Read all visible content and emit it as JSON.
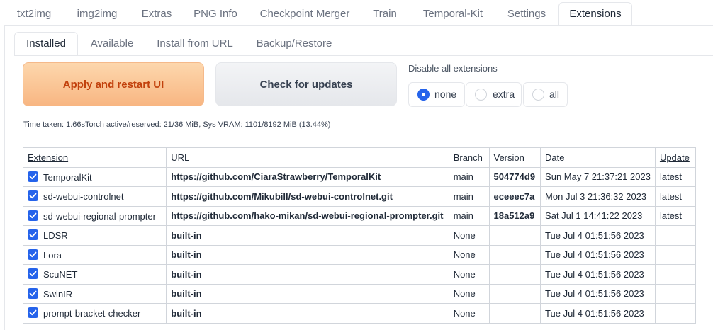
{
  "top_tabs": [
    {
      "label": "txt2img"
    },
    {
      "label": "img2img"
    },
    {
      "label": "Extras"
    },
    {
      "label": "PNG Info"
    },
    {
      "label": "Checkpoint Merger"
    },
    {
      "label": "Train"
    },
    {
      "label": "Temporal-Kit"
    },
    {
      "label": "Settings"
    },
    {
      "label": "Extensions"
    }
  ],
  "sub_tabs": [
    {
      "label": "Installed"
    },
    {
      "label": "Available"
    },
    {
      "label": "Install from URL"
    },
    {
      "label": "Backup/Restore"
    }
  ],
  "buttons": {
    "apply": "Apply and restart UI",
    "check": "Check for updates"
  },
  "disable": {
    "title": "Disable all extensions",
    "options": [
      "none",
      "extra",
      "all"
    ],
    "selected": "none"
  },
  "time_text": "Time taken: 1.66sTorch active/reserved: 21/36 MiB, Sys VRAM: 1101/8192 MiB (13.44%)",
  "table": {
    "headers": [
      "Extension",
      "URL",
      "Branch",
      "Version",
      "Date",
      "Update"
    ],
    "rows": [
      {
        "name": "TemporalKit",
        "url": "https://github.com/CiaraStrawberry/TemporalKit",
        "branch": "main",
        "version": "504774d9",
        "date": "Sun May 7 21:37:21 2023",
        "update": "latest",
        "checked": true
      },
      {
        "name": "sd-webui-controlnet",
        "url": "https://github.com/Mikubill/sd-webui-controlnet.git",
        "branch": "main",
        "version": "eceeec7a",
        "date": "Mon Jul 3 21:36:32 2023",
        "update": "latest",
        "checked": true
      },
      {
        "name": "sd-webui-regional-prompter",
        "url": "https://github.com/hako-mikan/sd-webui-regional-prompter.git",
        "branch": "main",
        "version": "18a512a9",
        "date": "Sat Jul 1 14:41:22 2023",
        "update": "latest",
        "checked": true
      },
      {
        "name": "LDSR",
        "url": "built-in",
        "branch": "None",
        "version": "",
        "date": "Tue Jul 4 01:51:56 2023",
        "update": "",
        "checked": true
      },
      {
        "name": "Lora",
        "url": "built-in",
        "branch": "None",
        "version": "",
        "date": "Tue Jul 4 01:51:56 2023",
        "update": "",
        "checked": true
      },
      {
        "name": "ScuNET",
        "url": "built-in",
        "branch": "None",
        "version": "",
        "date": "Tue Jul 4 01:51:56 2023",
        "update": "",
        "checked": true
      },
      {
        "name": "SwinIR",
        "url": "built-in",
        "branch": "None",
        "version": "",
        "date": "Tue Jul 4 01:51:56 2023",
        "update": "",
        "checked": true
      },
      {
        "name": "prompt-bracket-checker",
        "url": "built-in",
        "branch": "None",
        "version": "",
        "date": "Tue Jul 4 01:51:56 2023",
        "update": "",
        "checked": true
      }
    ]
  },
  "colors": {
    "accent": "#2563eb",
    "primary_button": "#f8b682",
    "primary_text": "#c2410c"
  }
}
